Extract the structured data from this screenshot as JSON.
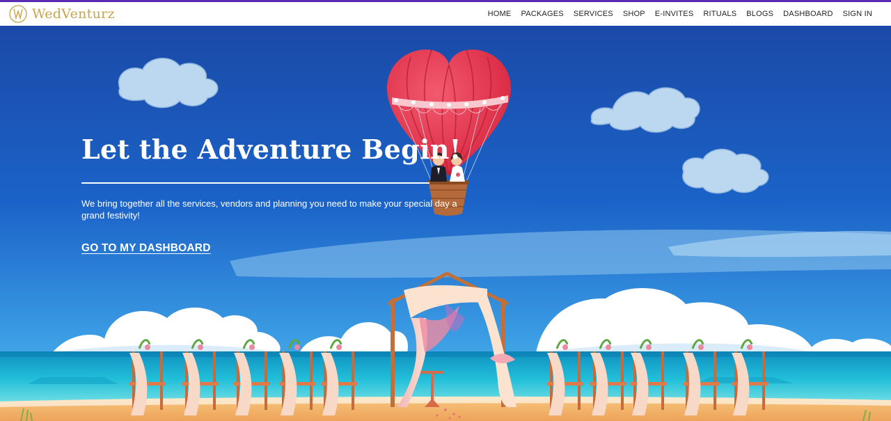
{
  "brand": {
    "name": "WedVenturz"
  },
  "nav": {
    "items": [
      "HOME",
      "PACKAGES",
      "SERVICES",
      "SHOP",
      "E-INVITES",
      "RITUALS",
      "BLOGS",
      "DASHBOARD",
      "SIGN IN"
    ]
  },
  "hero": {
    "title": "Let the Adventure Begin!",
    "subtitle": "We bring together all the services, vendors and planning you need to make your special day a grand festivity!",
    "cta": "GO TO MY DASHBOARD"
  },
  "colors": {
    "accent_topline": "#5b2bb3",
    "brand_gold": "#c8a44a",
    "sky_top": "#1a4fb0",
    "sea": "#1fb4d6",
    "sand": "#f2b46a",
    "balloon": "#e8354e"
  },
  "icons": [
    "logo-mark-icon"
  ]
}
